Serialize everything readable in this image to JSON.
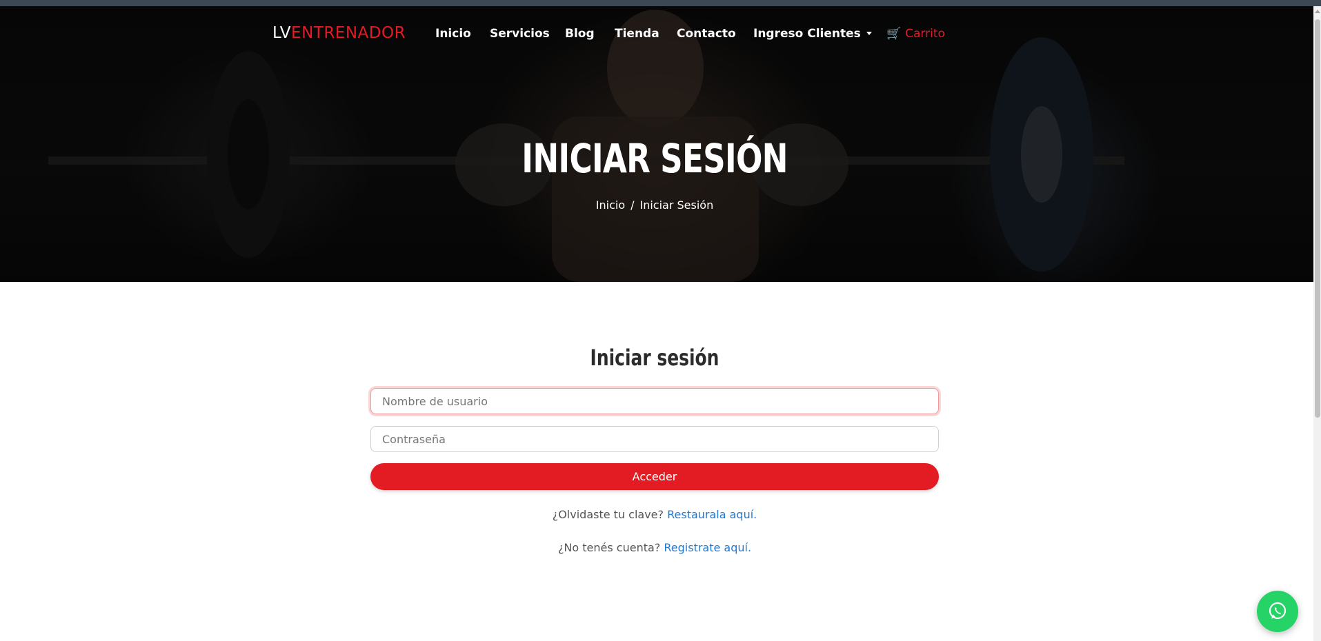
{
  "brand": {
    "part1": "LV",
    "part2": "ENTRENADOR"
  },
  "nav": {
    "items": [
      {
        "label": "Inicio"
      },
      {
        "label": "Servicios"
      },
      {
        "label": "Blog"
      },
      {
        "label": "Tienda"
      },
      {
        "label": "Contacto"
      },
      {
        "label": "Ingreso Clientes"
      }
    ],
    "cart_icon": "🛒",
    "cart_label": "Carrito"
  },
  "hero": {
    "title": "INICIAR SESIÓN",
    "breadcrumb": {
      "home": "Inicio",
      "separator": "/",
      "current": "Iniciar Sesión"
    }
  },
  "login": {
    "title": "Iniciar sesión",
    "username_placeholder": "Nombre de usuario",
    "username_value": "",
    "password_placeholder": "Contraseña",
    "password_value": "",
    "submit_label": "Acceder",
    "forgot_text": "¿Olvidaste tu clave?",
    "forgot_link": "Restaurala aquí.",
    "register_text": "¿No tenés cuenta?",
    "register_link": "Registrate aquí."
  },
  "colors": {
    "accent": "#e31b23",
    "link": "#1f7ad6",
    "whatsapp": "#25d366",
    "topbar": "#3d4855"
  },
  "icons": {
    "cart": "cart-icon",
    "dropdown": "chevron-down-icon",
    "whatsapp": "whatsapp-icon"
  }
}
